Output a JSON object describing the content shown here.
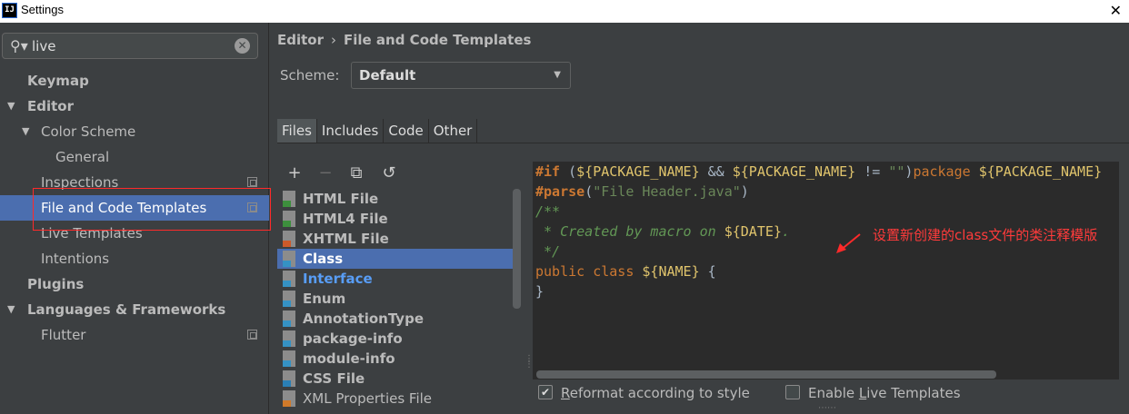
{
  "window": {
    "title": "Settings",
    "app_icon_text": "IJ"
  },
  "search": {
    "value": "live",
    "placeholder": ""
  },
  "sidebar": {
    "items": [
      {
        "label": "Keymap"
      },
      {
        "label": "Editor"
      },
      {
        "label": "Color Scheme"
      },
      {
        "label": "General"
      },
      {
        "label": "Inspections"
      },
      {
        "label": "File and Code Templates"
      },
      {
        "label": "Live Templates"
      },
      {
        "label": "Intentions"
      },
      {
        "label": "Plugins"
      },
      {
        "label": "Languages & Frameworks"
      },
      {
        "label": "Flutter"
      }
    ]
  },
  "breadcrumb": {
    "part1": "Editor",
    "separator": "›",
    "part2": "File and Code Templates"
  },
  "scheme": {
    "label": "Scheme:",
    "value": "Default"
  },
  "tabs": [
    {
      "label": "Files"
    },
    {
      "label": "Includes"
    },
    {
      "label": "Code"
    },
    {
      "label": "Other"
    }
  ],
  "toolbar": {
    "add": "+",
    "remove": "−",
    "copy": "⧉",
    "reset": "↺"
  },
  "templates": [
    {
      "label": "HTML File",
      "badge": "H"
    },
    {
      "label": "HTML4 File",
      "badge": "H"
    },
    {
      "label": "XHTML File",
      "badge": "H"
    },
    {
      "label": "Class",
      "badge": "J"
    },
    {
      "label": "Interface",
      "badge": "J"
    },
    {
      "label": "Enum",
      "badge": "J"
    },
    {
      "label": "AnnotationType",
      "badge": "J"
    },
    {
      "label": "package-info",
      "badge": "J"
    },
    {
      "label": "module-info",
      "badge": "J"
    },
    {
      "label": "CSS File",
      "badge": "CSS"
    },
    {
      "label": "XML Properties File",
      "badge": "<>"
    }
  ],
  "code": {
    "line1": {
      "kw_if": "#if",
      "p_open": " (",
      "v1": "${PACKAGE_NAME}",
      "and": " && ",
      "v2": "${PACKAGE_NAME}",
      "neq": " != ",
      "empty": "\"\"",
      "p_close": ")",
      "kw_package": "package ",
      "v3": "${PACKAGE_NAME}"
    },
    "line2": {
      "kw_parse": "#parse",
      "p_open": "(",
      "str": "\"File Header.java\"",
      "p_close": ")"
    },
    "line3": "/**",
    "line4": {
      "cmt": " * Created by macro on ",
      "v": "${DATE}",
      "end": "."
    },
    "line5": " */",
    "line6": {
      "text": "public class ",
      "v": "${NAME}",
      "brace": " {"
    },
    "line7": "}"
  },
  "annotation": "设置新创建的class文件的类注释模版",
  "options": {
    "reformat": {
      "pre": "",
      "u": "R",
      "post": "eformat according to style",
      "checked": true
    },
    "live_templates": {
      "pre": "Enable ",
      "u": "L",
      "post": "ive Templates",
      "checked": false
    }
  }
}
